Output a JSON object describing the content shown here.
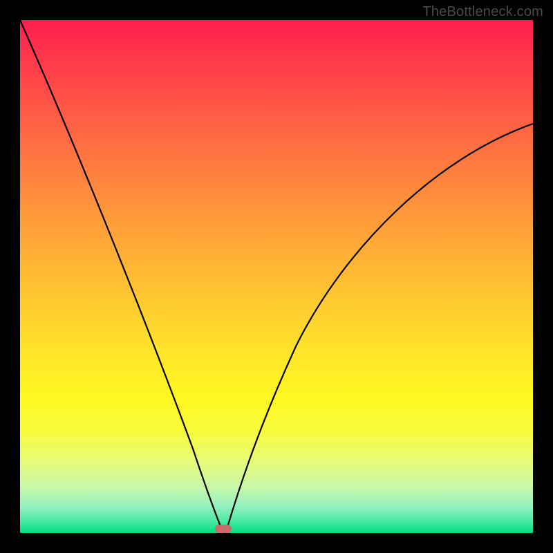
{
  "watermark": "TheBottleneck.com",
  "chart_data": {
    "type": "line",
    "title": "",
    "xlabel": "",
    "ylabel": "",
    "xlim": [
      0,
      100
    ],
    "ylim": [
      0,
      100
    ],
    "grid": false,
    "series": [
      {
        "name": "left-curve",
        "x": [
          0,
          5,
          10,
          15,
          20,
          25,
          28,
          32,
          35,
          37,
          38,
          39,
          39.5,
          39.8
        ],
        "y": [
          100,
          88,
          75,
          62,
          48,
          34,
          25,
          14,
          7,
          3,
          1.5,
          0.6,
          0.2,
          0
        ]
      },
      {
        "name": "right-curve",
        "x": [
          40.2,
          41,
          43,
          46,
          50,
          55,
          60,
          65,
          70,
          75,
          80,
          85,
          90,
          95,
          100
        ],
        "y": [
          0,
          1.5,
          6,
          13,
          22,
          32,
          41,
          49,
          56,
          62,
          67,
          71,
          74.5,
          77.5,
          80
        ]
      }
    ],
    "marker": {
      "x": 40,
      "y": 0,
      "color": "#cc6b6b"
    },
    "gradient_stops": [
      {
        "pos": 0,
        "color": "#ff1e4e"
      },
      {
        "pos": 50,
        "color": "#ffd22e"
      },
      {
        "pos": 80,
        "color": "#f8fc3c"
      },
      {
        "pos": 100,
        "color": "#00e080"
      }
    ]
  }
}
